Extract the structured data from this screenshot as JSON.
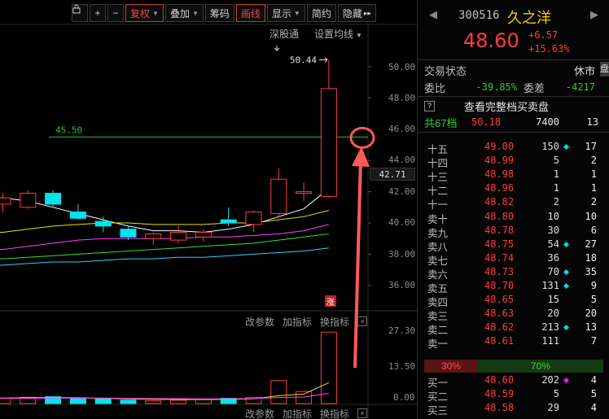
{
  "toolbar": {
    "buttons": [
      {
        "label": "复权",
        "dropdown": true,
        "highlight": true
      },
      {
        "label": "叠加",
        "dropdown": true,
        "highlight": false
      },
      {
        "label": "筹码",
        "dropdown": false,
        "highlight": false
      },
      {
        "label": "画线",
        "dropdown": false,
        "highlight": true
      },
      {
        "label": "显示",
        "dropdown": true,
        "highlight": false
      },
      {
        "label": "简约",
        "dropdown": false,
        "highlight": false
      },
      {
        "label": "隐藏",
        "dropdown": false,
        "highlight": false
      }
    ],
    "lock_icon": "lock-icon",
    "zoom_in": "+",
    "zoom_out": "−",
    "more": "▸▸"
  },
  "chart": {
    "exchange_label": "深股通",
    "ma_setting_label": "设置均线",
    "max_label": "50.44",
    "hline_label": "45.50",
    "current_price": "42.71",
    "limit_up_tag": "涨",
    "price_axis": [
      "50.00",
      "48.00",
      "46.00",
      "44.00",
      "42.00",
      "40.00",
      "38.00",
      "36.00"
    ],
    "indicator_controls": {
      "params": "改参数",
      "add": "加指标",
      "switch": "换指标",
      "close": "×"
    },
    "volume_axis": [
      "27.30",
      "13.50",
      "0.00"
    ],
    "colors": {
      "up": "#ff3c3c",
      "down": "#00e4f0",
      "hline": "#2fbf2f",
      "arrow": "#ff5a5a"
    }
  },
  "chart_data": {
    "type": "candlestick",
    "ylim": [
      35,
      51.5
    ],
    "hline": 45.5,
    "candles": [
      {
        "o": 41.2,
        "h": 41.9,
        "l": 40.7,
        "c": 41.6
      },
      {
        "o": 41.0,
        "h": 42.1,
        "l": 40.9,
        "c": 41.9
      },
      {
        "o": 41.9,
        "h": 42.1,
        "l": 41.0,
        "c": 41.2
      },
      {
        "o": 40.7,
        "h": 41.2,
        "l": 40.2,
        "c": 40.3
      },
      {
        "o": 40.1,
        "h": 40.4,
        "l": 39.4,
        "c": 39.8
      },
      {
        "o": 39.6,
        "h": 39.8,
        "l": 38.9,
        "c": 39.1
      },
      {
        "o": 39.0,
        "h": 39.4,
        "l": 38.6,
        "c": 39.3
      },
      {
        "o": 38.9,
        "h": 39.8,
        "l": 38.7,
        "c": 39.4
      },
      {
        "o": 39.1,
        "h": 39.6,
        "l": 38.8,
        "c": 39.4
      },
      {
        "o": 40.2,
        "h": 41.0,
        "l": 39.8,
        "c": 40.0
      },
      {
        "o": 39.9,
        "h": 40.8,
        "l": 39.4,
        "c": 40.7
      },
      {
        "o": 40.6,
        "h": 43.5,
        "l": 40.3,
        "c": 42.8
      },
      {
        "o": 41.9,
        "h": 42.6,
        "l": 41.4,
        "c": 42.0
      },
      {
        "o": 41.7,
        "h": 50.44,
        "l": 41.6,
        "c": 48.6
      }
    ],
    "ma": [
      {
        "color": "#ffffff",
        "values": [
          41.6,
          41.4,
          41.0,
          40.6,
          40.2,
          39.8,
          39.5,
          39.5,
          39.4,
          39.6,
          39.9,
          40.4,
          40.9,
          42.2
        ]
      },
      {
        "color": "#f0e000",
        "values": [
          39.4,
          39.6,
          39.8,
          39.9,
          40.0,
          40.0,
          39.9,
          39.9,
          39.9,
          40.0,
          40.0,
          40.2,
          40.4,
          40.8
        ]
      },
      {
        "color": "#ff40ff",
        "values": [
          38.3,
          38.5,
          38.7,
          38.9,
          39.0,
          39.0,
          39.0,
          39.0,
          39.1,
          39.1,
          39.2,
          39.3,
          39.5,
          39.9
        ]
      },
      {
        "color": "#30e030",
        "values": [
          37.7,
          37.8,
          37.9,
          38.0,
          38.1,
          38.2,
          38.3,
          38.4,
          38.5,
          38.6,
          38.7,
          38.9,
          39.1,
          39.3
        ]
      },
      {
        "color": "#30d0ff",
        "values": [
          37.3,
          37.4,
          37.5,
          37.5,
          37.6,
          37.7,
          37.7,
          37.8,
          37.8,
          37.9,
          38.0,
          38.1,
          38.2,
          38.4
        ]
      }
    ],
    "volume": [
      2.0,
      2.4,
      2.6,
      2.2,
      1.7,
      1.3,
      1.0,
      1.3,
      1.7,
      2.0,
      2.3,
      8.8,
      4.6,
      27.3
    ],
    "volume_ylim": [
      0,
      28
    ],
    "vol_ma": [
      {
        "color": "#f0e000",
        "values": [
          2.1,
          2.2,
          2.3,
          2.2,
          2.0,
          1.8,
          1.6,
          1.5,
          1.5,
          1.6,
          1.8,
          3.0,
          3.6,
          8.0
        ]
      },
      {
        "color": "#ff40ff",
        "values": [
          2.0,
          2.0,
          2.1,
          2.1,
          2.1,
          2.0,
          1.9,
          1.9,
          1.8,
          1.8,
          1.9,
          2.3,
          2.5,
          3.9
        ]
      }
    ]
  },
  "quote": {
    "code": "300516",
    "name": "久之洋",
    "price": "48.60",
    "change": "+6.57",
    "change_pct": "+15.63%",
    "status_label": "交易状态",
    "status_value": "休市",
    "ratio_label": "委比",
    "ratio_value": "-39.85%",
    "diff_label": "委差",
    "diff_value": "-4217",
    "full_book_icon": "?",
    "full_book_label": "查看完整档买卖盘",
    "total_label": "共67档",
    "total_price": "50.18",
    "total_vol": "7400",
    "total_num": "13",
    "asks": [
      {
        "label": "十五",
        "price": "49.00",
        "vol": "150",
        "dot": "cyan",
        "num": "17"
      },
      {
        "label": "十四",
        "price": "48.99",
        "vol": "5",
        "dot": "",
        "num": "2"
      },
      {
        "label": "十三",
        "price": "48.98",
        "vol": "1",
        "dot": "",
        "num": "1"
      },
      {
        "label": "十二",
        "price": "48.96",
        "vol": "1",
        "dot": "",
        "num": "1"
      },
      {
        "label": "十一",
        "price": "48.82",
        "vol": "2",
        "dot": "",
        "num": "2"
      },
      {
        "label": "卖十",
        "price": "48.80",
        "vol": "10",
        "dot": "",
        "num": "10"
      },
      {
        "label": "卖九",
        "price": "48.78",
        "vol": "30",
        "dot": "",
        "num": "6"
      },
      {
        "label": "卖八",
        "price": "48.75",
        "vol": "54",
        "dot": "cyan",
        "num": "27"
      },
      {
        "label": "卖七",
        "price": "48.74",
        "vol": "36",
        "dot": "",
        "num": "18"
      },
      {
        "label": "卖六",
        "price": "48.73",
        "vol": "70",
        "dot": "cyan",
        "num": "35"
      },
      {
        "label": "卖五",
        "price": "48.70",
        "vol": "131",
        "dot": "cyan",
        "num": "9"
      },
      {
        "label": "卖四",
        "price": "48.65",
        "vol": "15",
        "dot": "",
        "num": "5"
      },
      {
        "label": "卖三",
        "price": "48.63",
        "vol": "20",
        "dot": "",
        "num": "20"
      },
      {
        "label": "卖二",
        "price": "48.62",
        "vol": "213",
        "dot": "cyan",
        "num": "13"
      },
      {
        "label": "卖一",
        "price": "48.61",
        "vol": "111",
        "dot": "",
        "num": "7"
      }
    ],
    "buy_ratio": "30%",
    "sell_ratio": "70%",
    "bids": [
      {
        "label": "买一",
        "price": "48.60",
        "vol": "202",
        "dot": "mag",
        "num": "4"
      },
      {
        "label": "买二",
        "price": "48.59",
        "vol": "5",
        "dot": "",
        "num": "5"
      },
      {
        "label": "买三",
        "price": "48.58",
        "vol": "29",
        "dot": "",
        "num": "4"
      }
    ],
    "side_tab": "盘"
  }
}
